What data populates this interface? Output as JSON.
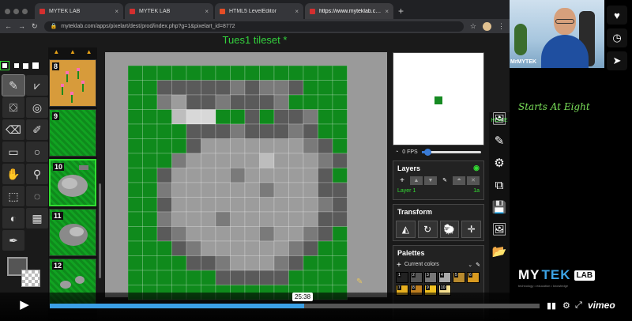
{
  "browser": {
    "tabs": [
      {
        "label": "MYTEK LAB",
        "active": false
      },
      {
        "label": "MYTEK LAB",
        "active": false
      },
      {
        "label": "HTML5 LevelEditor",
        "active": false
      },
      {
        "label": "https://www.myteklab.com/ap",
        "active": true
      }
    ],
    "url": "myteklab.com/apps/pixelart/dest/prod/index.php?g=1&pixelart_id=8772"
  },
  "app": {
    "title": "Tues1 tileset *",
    "tiles": [
      {
        "num": "8",
        "kind": "sand"
      },
      {
        "num": "9",
        "kind": "grass"
      },
      {
        "num": "10",
        "kind": "rock",
        "selected": true
      },
      {
        "num": "11",
        "kind": "rock"
      },
      {
        "num": "12",
        "kind": "rock-small"
      }
    ],
    "preview": {
      "fps_label": "0 FPS"
    },
    "layers": {
      "title": "Layers",
      "rows": [
        {
          "name": "Layer 1",
          "value": "1a"
        }
      ]
    },
    "transform": {
      "title": "Transform"
    },
    "palettes": {
      "title": "Palettes",
      "selected": "Current colors",
      "swatches": [
        {
          "n": "1",
          "color": "#222222"
        },
        {
          "n": "2",
          "color": "#555555"
        },
        {
          "n": "3",
          "color": "#777777"
        },
        {
          "n": "4",
          "color": "#aaaaaa"
        },
        {
          "n": "5",
          "color": "#b88a2e"
        },
        {
          "n": "6",
          "color": "#d89a20"
        },
        {
          "n": "7",
          "color": "#e8b020"
        },
        {
          "n": "8",
          "color": "#c08020"
        },
        {
          "n": "9",
          "color": "#f0c020"
        },
        {
          "n": "10",
          "color": "#f8e090"
        }
      ]
    },
    "home_label": "HOME"
  },
  "webcam": {
    "name": "MrMYTEK"
  },
  "overlay": {
    "starts_text": "Starts At Eight",
    "brand_my": "MY",
    "brand_tek": "TEK",
    "brand_lab": "LAB",
    "brand_tagline": "technology • education • knowledge"
  },
  "player": {
    "time": "25:38",
    "progress": 0.52,
    "brand": "vimeo"
  },
  "pixel_art": {
    "colors": {
      "G": "#0f8a1c",
      "g": "#14a626",
      "D": "#5a5a5a",
      "M": "#7a7a7a",
      "L": "#9c9c9c",
      "S": "#bdbdbd",
      "W": "#d8d8d8"
    },
    "rows": [
      "GGGGGGGGGGGGGGG",
      "GGDDDDDMDMMDGGG",
      "GGMLDDMDDDMGGGG",
      "GGGSWWGGDGDDMGG",
      "GGGGDDDMDDDMDGG",
      "GGGGDLLLLLLLMDG",
      "GGGMLLLLLSLLLMD",
      "GGDLLLLMLLLLLDG",
      "GGMLLLLLLMLLLDD",
      "GGDLLLLLLLLLLMD",
      "GGMLLLMLLLLLLDD",
      "GGDMLLLLLMLLMDG",
      "GGGDMLLLLLLMDGG",
      "GGGGDDMLLLMDGGG",
      "GGGGGGDDDDDGGGG",
      "GGGGGGGGGGGGGGG"
    ]
  }
}
